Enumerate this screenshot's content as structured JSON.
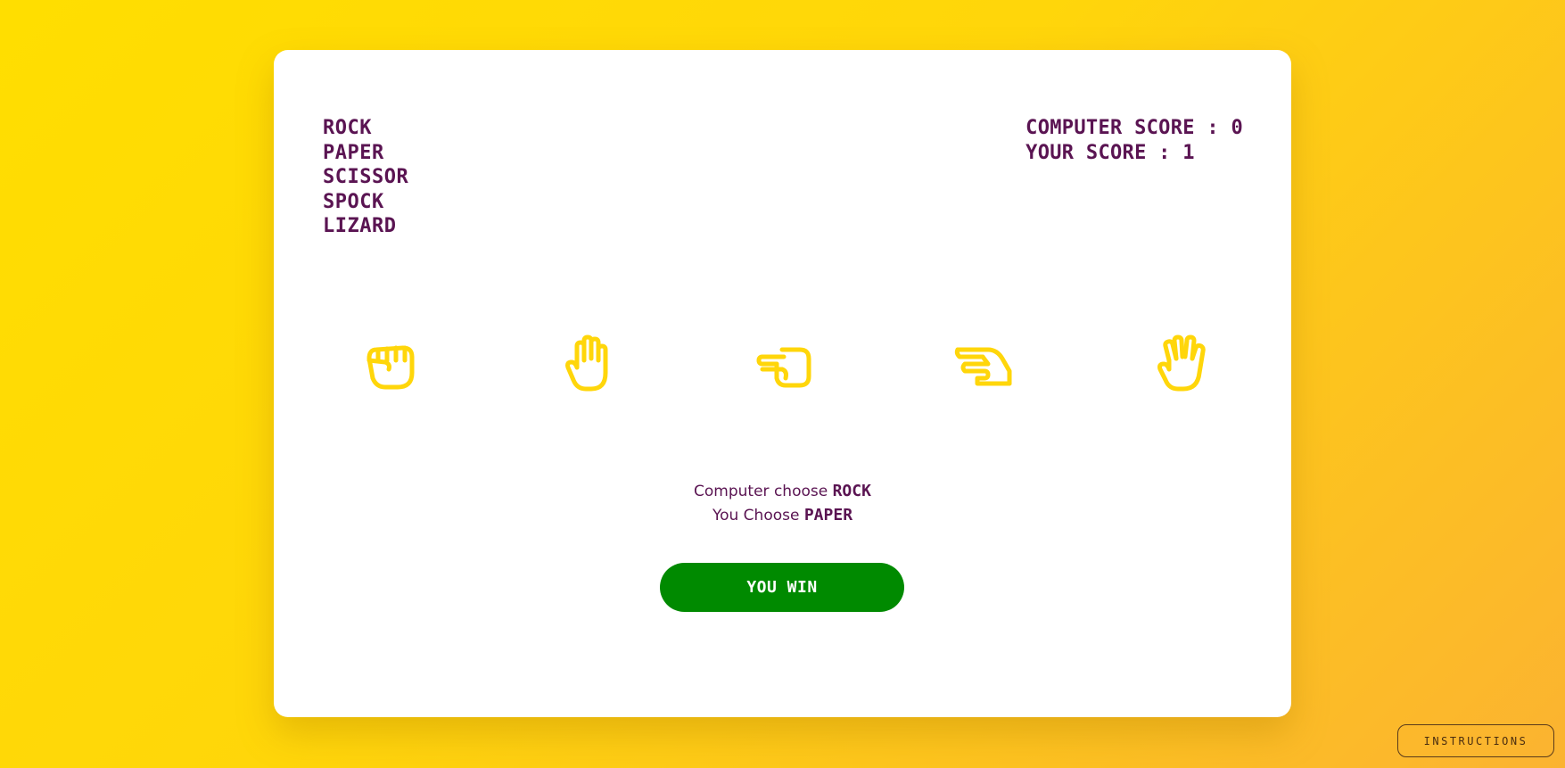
{
  "choices": [
    "ROCK",
    "PAPER",
    "SCISSOR",
    "SPOCK",
    "LIZARD"
  ],
  "score": {
    "computer_label": "COMPUTER SCORE :",
    "computer_value": "0",
    "user_label": "YOUR SCORE :",
    "user_value": "1"
  },
  "hands": [
    {
      "name": "rock",
      "icon": "fist-icon"
    },
    {
      "name": "paper",
      "icon": "open-hand-icon"
    },
    {
      "name": "scissor",
      "icon": "scissors-hand-icon"
    },
    {
      "name": "lizard",
      "icon": "lizard-hand-icon"
    },
    {
      "name": "spock",
      "icon": "spock-hand-icon"
    }
  ],
  "result": {
    "computer_prefix": "Computer choose",
    "computer_choice": "ROCK",
    "user_prefix": "You Choose",
    "user_choice": "PAPER",
    "outcome": "YOU WIN"
  },
  "instructions_label": "INSTRUCTIONS",
  "colors": {
    "accent": "#ffd60a",
    "text": "#5a1452",
    "win": "#008a00"
  }
}
